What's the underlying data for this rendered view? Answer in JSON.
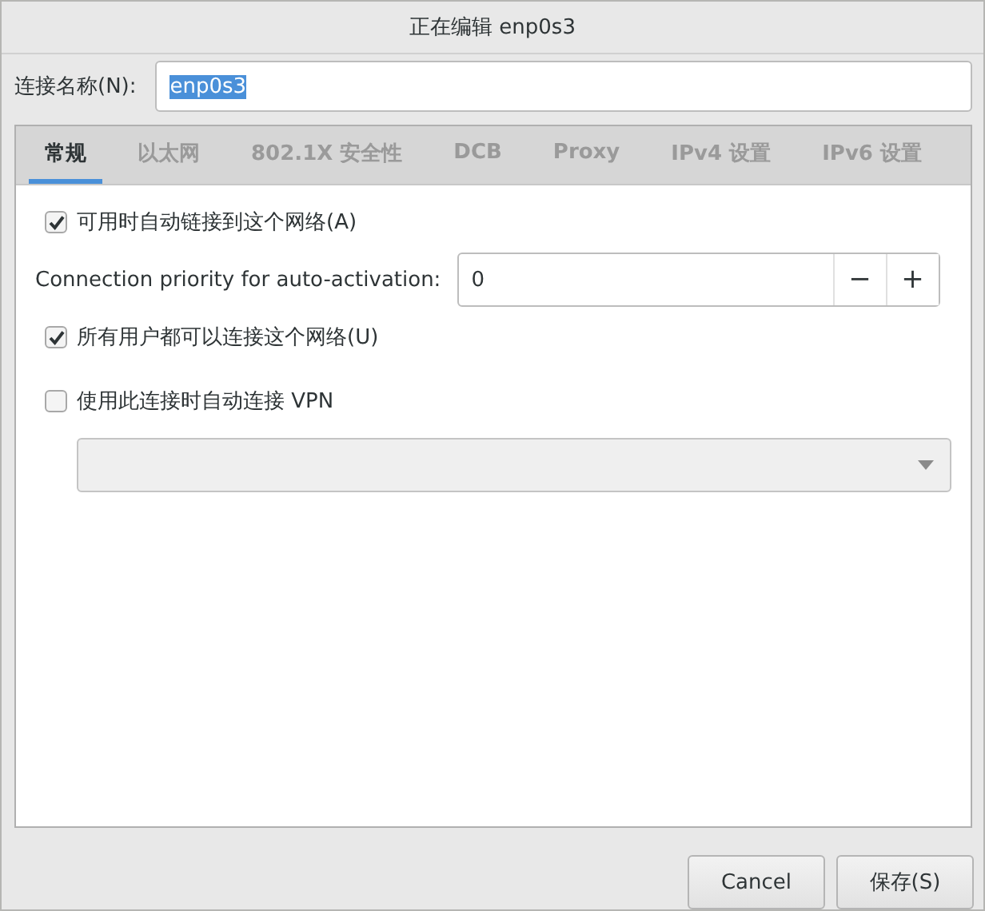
{
  "window": {
    "title": "正在编辑 enp0s3"
  },
  "connection_name": {
    "label": "连接名称(N):",
    "value": "enp0s3"
  },
  "tabs": [
    {
      "label": "常规",
      "selected": true
    },
    {
      "label": "以太网",
      "selected": false
    },
    {
      "label": "802.1X 安全性",
      "selected": false
    },
    {
      "label": "DCB",
      "selected": false
    },
    {
      "label": "Proxy",
      "selected": false
    },
    {
      "label": "IPv4 设置",
      "selected": false
    },
    {
      "label": "IPv6 设置",
      "selected": false
    }
  ],
  "auto_connect": {
    "label": "可用时自动链接到这个网络(A)",
    "checked": true
  },
  "priority": {
    "label": "Connection priority for auto-activation:",
    "value": "0",
    "decrement": "−",
    "increment": "+"
  },
  "all_users": {
    "label": "所有用户都可以连接这个网络(U)",
    "checked": true
  },
  "auto_vpn": {
    "label": "使用此连接时自动连接 VPN",
    "checked": false
  },
  "vpn_dropdown": {
    "disabled": true
  },
  "buttons": [
    "Cancel",
    "保存(S)"
  ]
}
